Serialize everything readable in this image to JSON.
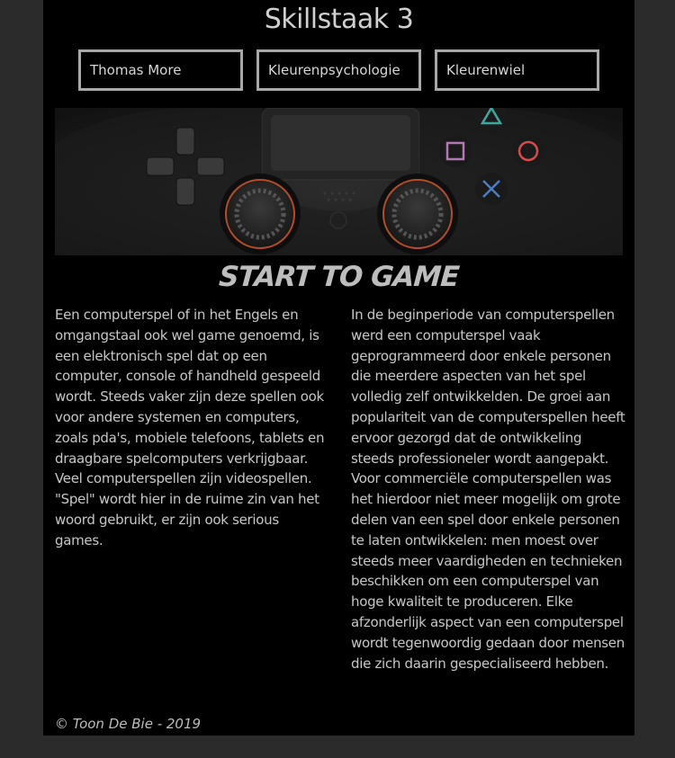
{
  "header": {
    "title": "Skillstaak 3"
  },
  "nav": {
    "items": [
      {
        "label": "Thomas More"
      },
      {
        "label": "Kleurenpsychologie"
      },
      {
        "label": "Kleurenwiel"
      }
    ]
  },
  "hero": {
    "icon": "game-controller-image",
    "colors": {
      "triangle": "#3fa7a0",
      "square": "#b478b4",
      "circle": "#d44c4c",
      "cross": "#4a7ec4"
    }
  },
  "main": {
    "heading": "START TO GAME",
    "left_paragraph": "Een computerspel of in het Engels en omgangstaal ook wel game genoemd, is een elektronisch spel dat op een computer, console of handheld gespeeld wordt. Steeds vaker zijn deze spellen ook voor andere systemen en computers, zoals pda's, mobiele telefoons, tablets en draagbare spelcomputers verkrijgbaar. Veel computerspellen zijn videospellen. \"Spel\" wordt hier in de ruime zin van het woord gebruikt, er zijn ook serious games.",
    "right_paragraph": "In de beginperiode van computerspellen werd een computerspel vaak geprogrammeerd door enkele personen die meerdere aspecten van het spel volledig zelf ontwikkelden. De groei aan populariteit van de computerspellen heeft ervoor gezorgd dat de ontwikkeling steeds professioneler wordt aangepakt. Voor commerciële computerspellen was het hierdoor niet meer mogelijk om grote delen van een spel door enkele personen te laten ontwikkelen: men moest over steeds meer vaardigheden en technieken beschikken om een computerspel van hoge kwaliteit te produceren. Elke afzonderlijk aspect van een computerspel wordt tegenwoordig gedaan door mensen die zich daarin gespecialiseerd hebben."
  },
  "footer": {
    "text": "© Toon De Bie - 2019"
  }
}
